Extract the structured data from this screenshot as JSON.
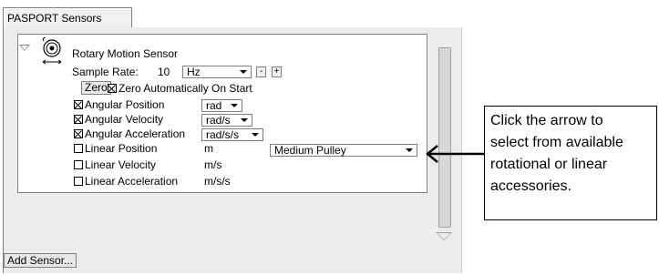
{
  "tab": {
    "label": "PASPORT Sensors"
  },
  "sensor": {
    "name": "Rotary Motion Sensor",
    "sample_rate_label": "Sample Rate:",
    "sample_rate_value": "10",
    "sample_rate_unit": "Hz",
    "decrease_label": "-",
    "increase_label": "+",
    "zero_button": "Zero",
    "zero_auto_label": "Zero Automatically On Start",
    "zero_auto_checked": true,
    "measurements": [
      {
        "label": "Angular Position",
        "checked": true,
        "unit": "rad",
        "unit_is_select": true
      },
      {
        "label": "Angular Velocity",
        "checked": true,
        "unit": "rad/s",
        "unit_is_select": true
      },
      {
        "label": "Angular Acceleration",
        "checked": true,
        "unit": "rad/s/s",
        "unit_is_select": true
      },
      {
        "label": "Linear Position",
        "checked": false,
        "unit": "m",
        "unit_is_select": false
      },
      {
        "label": "Linear Velocity",
        "checked": false,
        "unit": "m/s",
        "unit_is_select": false
      },
      {
        "label": "Linear Acceleration",
        "checked": false,
        "unit": "m/s/s",
        "unit_is_select": false
      }
    ],
    "accessory": "Medium Pulley"
  },
  "add_sensor_button": "Add Sensor...",
  "callout": {
    "line1": "Click the arrow to",
    "line2": "select from available",
    "line3": "rotational or linear",
    "line4": "accessories."
  }
}
